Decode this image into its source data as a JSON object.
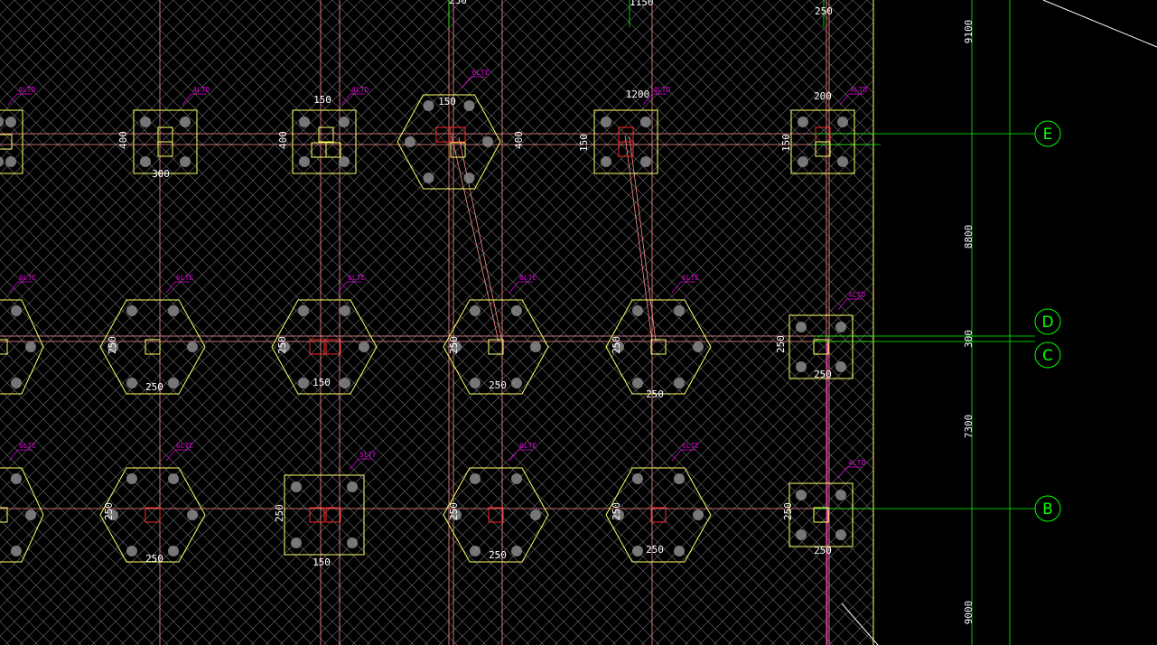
{
  "colors": {
    "background": "#000000",
    "hatch": "#6f6f6f",
    "grid_line": "#ff8f8f",
    "axis_line": "#00ff00",
    "pile_cap": "#ffff66",
    "column": "#ffff66",
    "column_alt": "#ff2a2a",
    "pile": "#8a8a8a",
    "tag": "#e000e0",
    "dim_text": "#ffffff"
  },
  "axes": [
    {
      "label": "E"
    },
    {
      "label": "D"
    },
    {
      "label": "C"
    },
    {
      "label": "B"
    }
  ],
  "axis_dims": [
    "9100",
    "8800",
    "300",
    "7300",
    "9000"
  ],
  "top_dims": [
    "250",
    "1150",
    "250"
  ],
  "row_e": {
    "caps": [
      {
        "tag": "4LTD",
        "dims": []
      },
      {
        "tag": "4LTD",
        "dims": [
          "400",
          "300"
        ]
      },
      {
        "tag": "4LTD",
        "dims": [
          "150",
          "400"
        ]
      },
      {
        "tag": "6LTE",
        "dims": [
          "150",
          "400"
        ]
      },
      {
        "tag": "4LTD",
        "dims": [
          "1200",
          "150"
        ]
      },
      {
        "tag": "4LTD",
        "dims": [
          "200",
          "150"
        ]
      }
    ]
  },
  "row_dc": {
    "caps": [
      {
        "tag": "6LTE",
        "dims": []
      },
      {
        "tag": "6LTE",
        "dims": [
          "250",
          "250"
        ]
      },
      {
        "tag": "6LTE",
        "dims": [
          "250",
          "150"
        ]
      },
      {
        "tag": "6LTE",
        "dims": [
          "250",
          "250"
        ]
      },
      {
        "tag": "6LTE",
        "dims": [
          "250",
          "250"
        ]
      },
      {
        "tag": "4LTD",
        "dims": [
          "250",
          "250"
        ]
      }
    ]
  },
  "row_b": {
    "caps": [
      {
        "tag": "6LTE",
        "dims": []
      },
      {
        "tag": "6LTE",
        "dims": [
          "250",
          "250"
        ]
      },
      {
        "tag": "5LTF",
        "dims": [
          "250",
          "150"
        ]
      },
      {
        "tag": "6LTE",
        "dims": [
          "250",
          "250"
        ]
      },
      {
        "tag": "6LTE",
        "dims": [
          "250",
          "250"
        ]
      },
      {
        "tag": "4LTD",
        "dims": [
          "250",
          "250"
        ]
      }
    ]
  }
}
